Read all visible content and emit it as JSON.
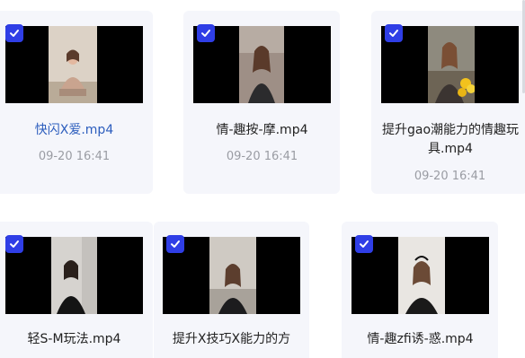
{
  "files": [
    {
      "name": "快闪X爱.mp4",
      "time": "09-20 16:41",
      "selected": true,
      "active": true
    },
    {
      "name": "情-趣按-摩.mp4",
      "time": "09-20 16:41",
      "selected": true
    },
    {
      "name": "提升gao潮能力的情趣玩具.mp4",
      "time": "09-20 16:41",
      "selected": true
    },
    {
      "name": "轻S-M玩法.mp4",
      "selected": true
    },
    {
      "name": "提升X技巧X能力的方",
      "selected": true
    },
    {
      "name": "情-趣zfi诱-惑.mp4",
      "selected": true
    }
  ],
  "colors": {
    "accent": "#2f3ee6",
    "active_name": "#2c5dbd",
    "card_bg": "#f5f6fb",
    "time_text": "#9a9ca3"
  }
}
